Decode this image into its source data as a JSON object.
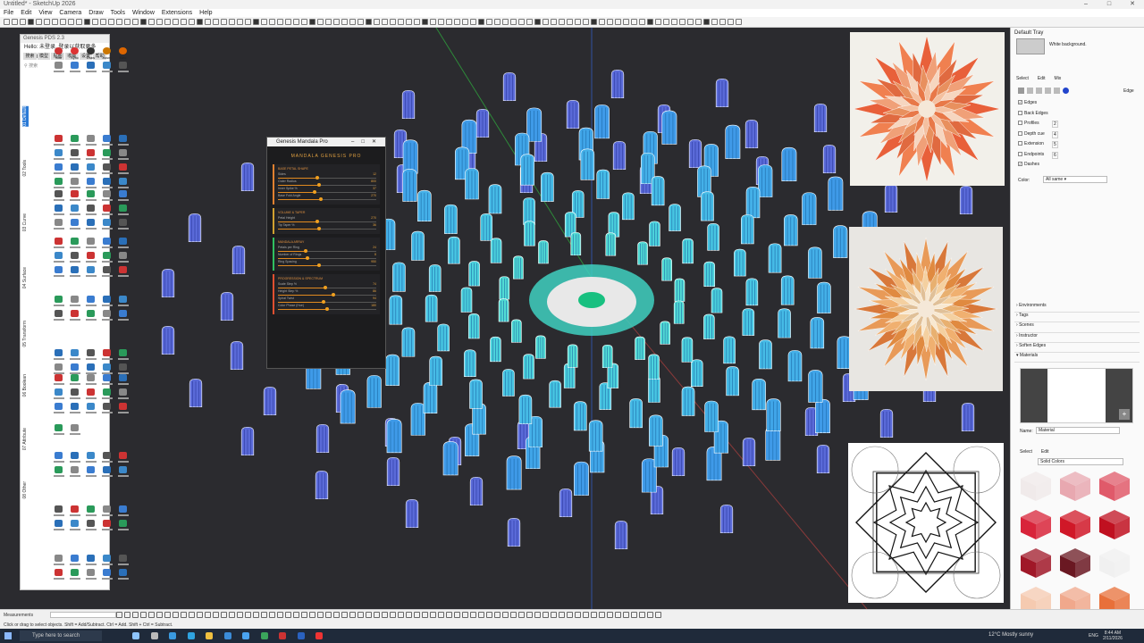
{
  "window": {
    "title": "Untitled* - SketchUp 2026"
  },
  "menu": [
    "File",
    "Edit",
    "View",
    "Camera",
    "Draw",
    "Tools",
    "Window",
    "Extensions",
    "Help"
  ],
  "plugin": {
    "title": "Genesis PDS 2.3",
    "hello": "Hello: 未登录, 登录以获取更多sketchup",
    "tabs": [
      "搜索",
      "模型",
      "贴图",
      "收藏",
      "设置",
      "帮助"
    ],
    "search_placeholder": "搜索",
    "vertical_tabs": [
      "01 Default",
      "02 Tools",
      "03 Curve",
      "04 Surface",
      "05 Transform",
      "06 Boolean",
      "07 Attribute",
      "08 Other"
    ],
    "first_row_labels": [
      "Star",
      "Sync",
      "Draw",
      "Assm",
      "Elec"
    ],
    "first_row_icon_colors": [
      "#c33",
      "#d33",
      "#333",
      "#c70",
      "#d60"
    ]
  },
  "dialog": {
    "title": "Genesis Mandala Pro",
    "header": "MANDALA GENESIS PRO",
    "sections": [
      {
        "title": "BASE PETAL SHAPE",
        "rows": [
          {
            "label": "Sides",
            "value": "12",
            "level": 0.4
          },
          {
            "label": "Outer Radius",
            "value": "800",
            "level": 0.42
          },
          {
            "label": "Inner Spike %",
            "value": "37",
            "level": 0.37
          },
          {
            "label": "Base Fold Angle",
            "value": "270",
            "level": 0.44
          }
        ]
      },
      {
        "title": "VOLUME & TAPER",
        "rows": [
          {
            "label": "Petal Height",
            "value": "270",
            "level": 0.4
          },
          {
            "label": "Tip Taper %",
            "value": "36",
            "level": 0.42
          }
        ]
      },
      {
        "title": "MANDALA ARRAY",
        "rows": [
          {
            "label": "Petals per Ring",
            "value": "24",
            "level": 0.28
          },
          {
            "label": "Number of Rings",
            "value": "8",
            "level": 0.3
          },
          {
            "label": "Ring Spacing",
            "value": "950",
            "level": 0.42
          }
        ]
      },
      {
        "title": "PROGRESSION & SPECTRUM",
        "rows": [
          {
            "label": "Scale Step %",
            "value": "74",
            "level": 0.48
          },
          {
            "label": "Height Step %",
            "value": "86",
            "level": 0.56
          },
          {
            "label": "Spiral Twist",
            "value": "94",
            "level": 0.46
          },
          {
            "label": "Color Phase (Hue)",
            "value": "180",
            "level": 0.5
          }
        ]
      }
    ]
  },
  "tray": {
    "title": "Default Tray",
    "style_desc": "White background.",
    "style_tabs": [
      "Select",
      "Edit",
      "Mix"
    ],
    "edges_label": "Edge",
    "edge_options": [
      {
        "label": "Edges",
        "checked": true,
        "value": ""
      },
      {
        "label": "Back Edges",
        "checked": false,
        "value": ""
      },
      {
        "label": "Profiles",
        "checked": false,
        "value": "2"
      },
      {
        "label": "Depth cue",
        "checked": false,
        "value": "4"
      },
      {
        "label": "Extension",
        "checked": false,
        "value": "5"
      },
      {
        "label": "Endpoints",
        "checked": false,
        "value": "6"
      },
      {
        "label": "Dashes",
        "checked": true,
        "value": ""
      }
    ],
    "color_label": "Color:",
    "color_value": "All same",
    "panels": [
      "Environments",
      "Tags",
      "Scenes",
      "Instructor",
      "Soften Edges",
      "Materials"
    ],
    "material_name_label": "Name:",
    "material_name": "Material",
    "mat_tabs": [
      "Select",
      "Edit"
    ],
    "mat_library": "Solid Colors",
    "swatches": [
      "#f0eaea",
      "#e8a8b0",
      "#e05a6a",
      "#d8243a",
      "#d01828",
      "#c01020",
      "#a01828",
      "#6a1822",
      "#f0f0f0",
      "#f5cab0",
      "#f0a88c",
      "#e8703a"
    ]
  },
  "status": {
    "measurements_label": "Measurements",
    "hint": "Click or drag to select objects. Shift = Add/Subtract. Ctrl = Add. Shift + Ctrl = Subtract."
  },
  "taskbar": {
    "search": "Type here to search",
    "weather": "12°C  Mostly sunny",
    "lang": "ENG",
    "time": "8:44 AM",
    "date": "2/11/2026"
  },
  "colors": {
    "viewport": "#2b2b2f",
    "petal": "#4aa8e8",
    "accent": "#e08a20"
  }
}
